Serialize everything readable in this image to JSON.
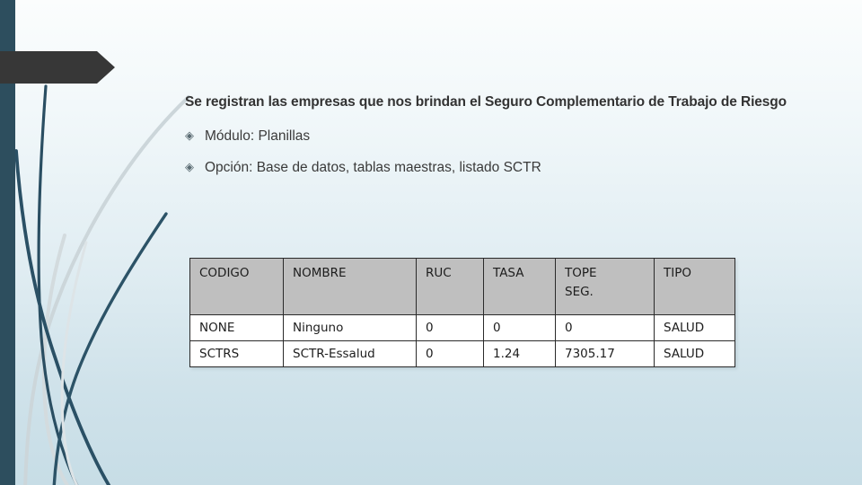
{
  "slide": {
    "headline": "Se registran las empresas que nos brindan el Seguro Complementario de Trabajo de Riesgo",
    "bullets": [
      {
        "glyph": "◈",
        "text": "Módulo: Planillas"
      },
      {
        "glyph": "◈",
        "text": "Opción: Base de datos, tablas maestras, listado SCTR"
      }
    ]
  },
  "table": {
    "headers": [
      "CODIGO",
      "NOMBRE",
      "RUC",
      "TASA",
      "TOPE\nSEG.",
      "TIPO"
    ],
    "rows": [
      [
        "NONE",
        "Ninguno",
        "0",
        "0",
        "0",
        "SALUD"
      ],
      [
        "SCTRS",
        "SCTR-Essalud",
        "0",
        "1.24",
        "7305.17",
        "SALUD"
      ]
    ]
  },
  "decor": {
    "bar_color": "#2d4e5e",
    "banner_color": "#373737",
    "header_fill": "#bfbfbf",
    "bg_top": "#fbfdfd",
    "bg_bottom": "#c7dde6",
    "swoosh_dark": "#2a4e62",
    "swoosh_light": "#ccd6da"
  }
}
